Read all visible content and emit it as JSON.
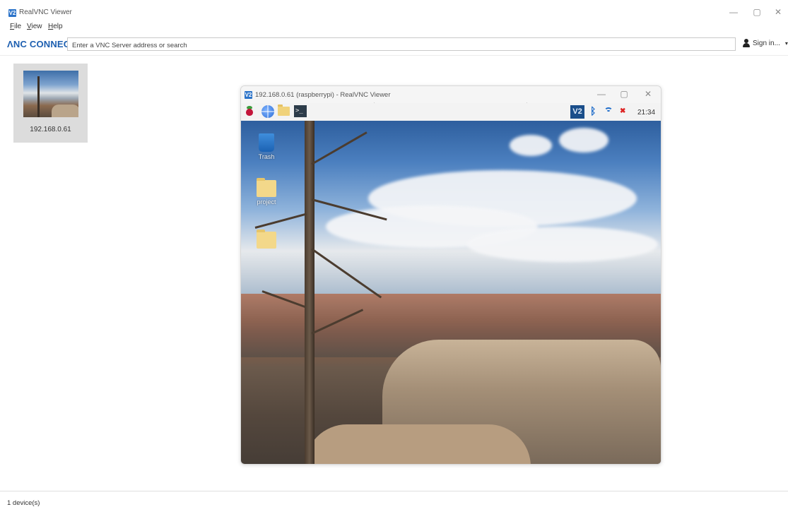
{
  "window": {
    "title": "RealVNC Viewer",
    "logo_glyph": "V2",
    "controls": {
      "minimize": "—",
      "restore": "▢",
      "close": "✕"
    }
  },
  "menu": {
    "items": [
      {
        "first": "F",
        "rest": "ile"
      },
      {
        "first": "V",
        "rest": "iew"
      },
      {
        "first": "H",
        "rest": "elp"
      }
    ]
  },
  "toolbar": {
    "brand": "ɅNC CONNECT",
    "search_placeholder": "Enter a VNC Server address or search",
    "search_value": "",
    "signin_label": "Sign in...",
    "signin_caret": "▾"
  },
  "device": {
    "label": "192.168.0.61"
  },
  "remote": {
    "title": "192.168.0.61 (raspberrypi) - RealVNC Viewer",
    "logo_glyph": "V2",
    "controls": {
      "minimize": "—",
      "restore": "▢",
      "close": "✕"
    },
    "panel": {
      "terminal_glyph": ">_",
      "vnc_glyph": "V2",
      "bluetooth_glyph": "ᛒ",
      "volume_glyph": "✖",
      "clock": "21:34"
    },
    "desktop_icons": [
      {
        "label": "Trash",
        "icon": "trash-icon"
      },
      {
        "label": "project",
        "icon": "folder-icon"
      },
      {
        "label": "",
        "icon": "folder-icon"
      }
    ]
  },
  "status": {
    "text": "1 device(s)"
  },
  "colors": {
    "brand": "#1d5fb0",
    "tile_bg": "#dcdcdc",
    "vnc_logo": "#2b73c9"
  }
}
